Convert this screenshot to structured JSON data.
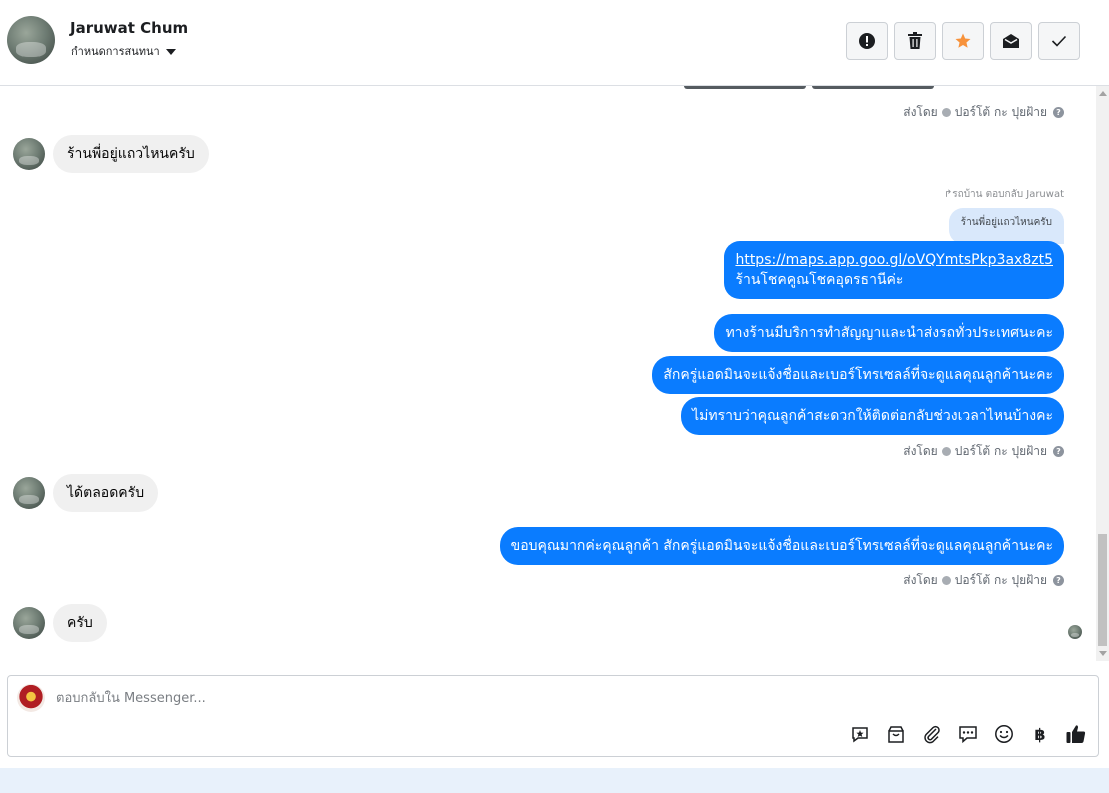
{
  "header": {
    "contact_name": "Jaruwat Chum",
    "assign_label": "กำหนดการสนทนา",
    "actions": [
      {
        "name": "report-button",
        "icon": "exclamation-circle-icon"
      },
      {
        "name": "delete-button",
        "icon": "trash-icon"
      },
      {
        "name": "star-button",
        "icon": "star-icon",
        "color": "#f7923b"
      },
      {
        "name": "mark-unread-button",
        "icon": "envelope-icon"
      },
      {
        "name": "mark-done-button",
        "icon": "checkmark-icon"
      }
    ]
  },
  "thread": {
    "sent_by_label": "ส่งโดย",
    "sender_name": "ปอร์โต้ กะ ปุยฝ้าย",
    "help_glyph": "?",
    "messages": [
      {
        "dir": "in",
        "text": "ร้านพี่อยู่แถวไหนครับ"
      },
      {
        "dir": "out",
        "reply_label": "รถบ้าน ตอบกลับ Jaruwat",
        "quoted": "ร้านพี่อยู่แถวไหนครับ",
        "link": "https://maps.app.goo.gl/oVQYmtsPkp3ax8zt5",
        "text": "ร้านโชคคูณโชคอุดรธานีค่ะ"
      },
      {
        "dir": "out",
        "text": "ทางร้านมีบริการทำสัญญาและนำส่งรถทั่วประเทศนะคะ"
      },
      {
        "dir": "out",
        "text": "สักครู่แอดมินจะแจ้งชื่อและเบอร์โทรเซลล์ที่จะดูแลคุณลูกค้านะคะ"
      },
      {
        "dir": "out",
        "text": "ไม่ทราบว่าคุณลูกค้าสะดวกให้ติดต่อกลับช่วงเวลาไหนบ้างคะ"
      },
      {
        "dir": "in",
        "text": "ได้ตลอดครับ"
      },
      {
        "dir": "out",
        "text": "ขอบคุณมากค่ะคุณลูกค้า  สักครู่แอดมินจะแจ้งชื่อและเบอร์โทรเซลล์ที่จะดูแลคุณลูกค้านะคะ"
      },
      {
        "dir": "in",
        "text": "ครับ"
      }
    ]
  },
  "composer": {
    "placeholder": "ตอบกลับใน Messenger...",
    "tools": [
      {
        "name": "saved-reply-button",
        "icon": "saved-reply-icon"
      },
      {
        "name": "shop-button",
        "icon": "shopping-bag-icon"
      },
      {
        "name": "attach-button",
        "icon": "paperclip-icon"
      },
      {
        "name": "quick-reply-button",
        "icon": "chat-bubbles-icon"
      },
      {
        "name": "emoji-button",
        "icon": "smiley-icon"
      },
      {
        "name": "payment-button",
        "icon": "baht-icon",
        "glyph": "฿"
      },
      {
        "name": "like-button",
        "icon": "thumbs-up-icon"
      }
    ]
  }
}
